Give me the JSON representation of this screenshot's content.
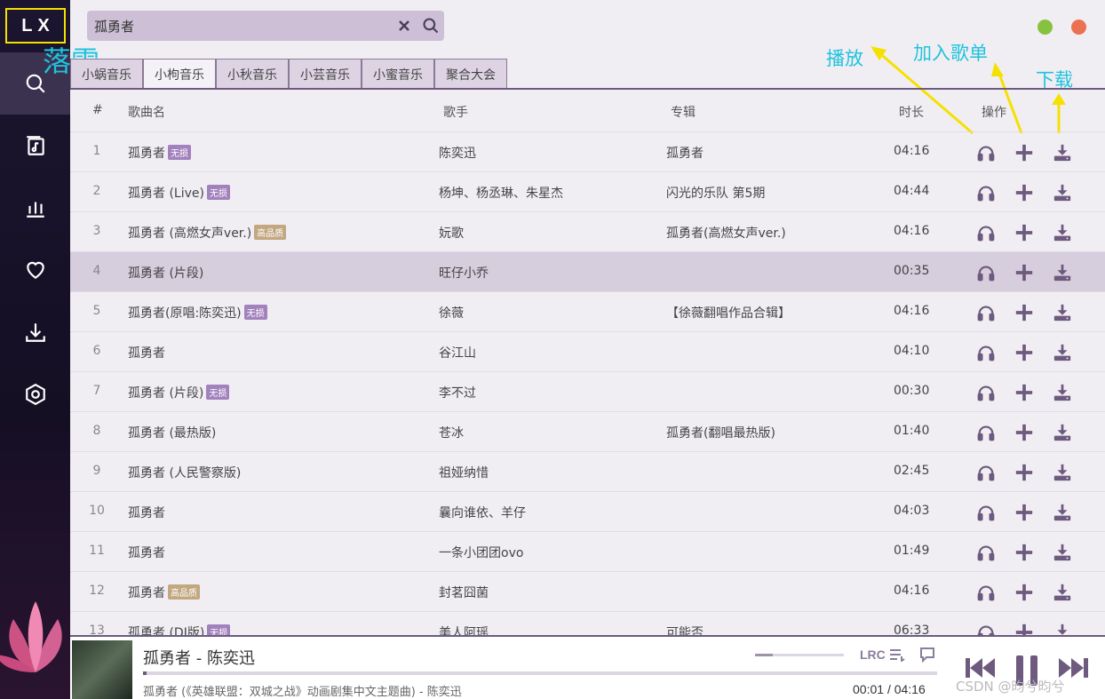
{
  "app": {
    "logo": "LX"
  },
  "annotations": {
    "user_label": "落雪",
    "play_label": "播放",
    "add_label": "加入歌单",
    "download_label": "下载"
  },
  "search": {
    "value": "孤勇者"
  },
  "tabs": [
    "小蜗音乐",
    "小枸音乐",
    "小秋音乐",
    "小芸音乐",
    "小蜜音乐",
    "聚合大会"
  ],
  "active_tab": 1,
  "table": {
    "headers": {
      "num": "#",
      "name": "歌曲名",
      "artist": "歌手",
      "album": "专辑",
      "duration": "时长",
      "ops": "操作"
    },
    "rows": [
      {
        "num": "1",
        "name": "孤勇者",
        "badge": "无损",
        "artist": "陈奕迅",
        "album": "孤勇者",
        "duration": "04:16"
      },
      {
        "num": "2",
        "name": "孤勇者 (Live)",
        "badge": "无损",
        "artist": "杨坤、杨丞琳、朱星杰",
        "album": "闪光的乐队 第5期",
        "duration": "04:44"
      },
      {
        "num": "3",
        "name": "孤勇者 (高燃女声ver.)",
        "badge": "高品质",
        "artist": "妧歌",
        "album": "孤勇者(高燃女声ver.)",
        "duration": "04:16"
      },
      {
        "num": "4",
        "name": "孤勇者 (片段)",
        "badge": "",
        "artist": "旺仔小乔",
        "album": "",
        "duration": "00:35"
      },
      {
        "num": "5",
        "name": "孤勇者(原唱:陈奕迅)",
        "badge": "无损",
        "artist": "徐薇",
        "album": "【徐薇翻唱作品合辑】",
        "duration": "04:16"
      },
      {
        "num": "6",
        "name": "孤勇者",
        "badge": "",
        "artist": "谷江山",
        "album": "",
        "duration": "04:10"
      },
      {
        "num": "7",
        "name": "孤勇者 (片段)",
        "badge": "无损",
        "artist": "李不过",
        "album": "",
        "duration": "00:30"
      },
      {
        "num": "8",
        "name": "孤勇者 (最热版)",
        "badge": "",
        "artist": "苍冰",
        "album": "孤勇者(翻唱最热版)",
        "duration": "01:40"
      },
      {
        "num": "9",
        "name": "孤勇者 (人民警察版)",
        "badge": "",
        "artist": "祖娅纳惜",
        "album": "",
        "duration": "02:45"
      },
      {
        "num": "10",
        "name": "孤勇者",
        "badge": "",
        "artist": "曩向谁依、羊仔",
        "album": "",
        "duration": "04:03"
      },
      {
        "num": "11",
        "name": "孤勇者",
        "badge": "",
        "artist": "一条小团团ovo",
        "album": "",
        "duration": "01:49"
      },
      {
        "num": "12",
        "name": "孤勇者",
        "badge": "高品质",
        "artist": "封茗囧菌",
        "album": "",
        "duration": "04:16"
      },
      {
        "num": "13",
        "name": "孤勇者 (DJ版)",
        "badge": "无损",
        "artist": "美人阿瑶",
        "album": "可能否",
        "duration": "06:33"
      }
    ],
    "highlighted_row": 3
  },
  "player": {
    "title": "孤勇者 - 陈奕迅",
    "subtitle": "孤勇者 (《英雄联盟：双城之战》动画剧集中文主题曲) - 陈奕迅",
    "current": "00:01",
    "separator": "/",
    "total": "04:16",
    "lrc_label": "LRC",
    "progress": 0.004
  },
  "watermark": "CSDN @昀兮昀兮",
  "colors": {
    "accent": "#6d5a7e",
    "annotation": "#1fc3dd",
    "arrow": "#f5e100",
    "lossless": "#a282bd",
    "hq": "#c2a781"
  }
}
